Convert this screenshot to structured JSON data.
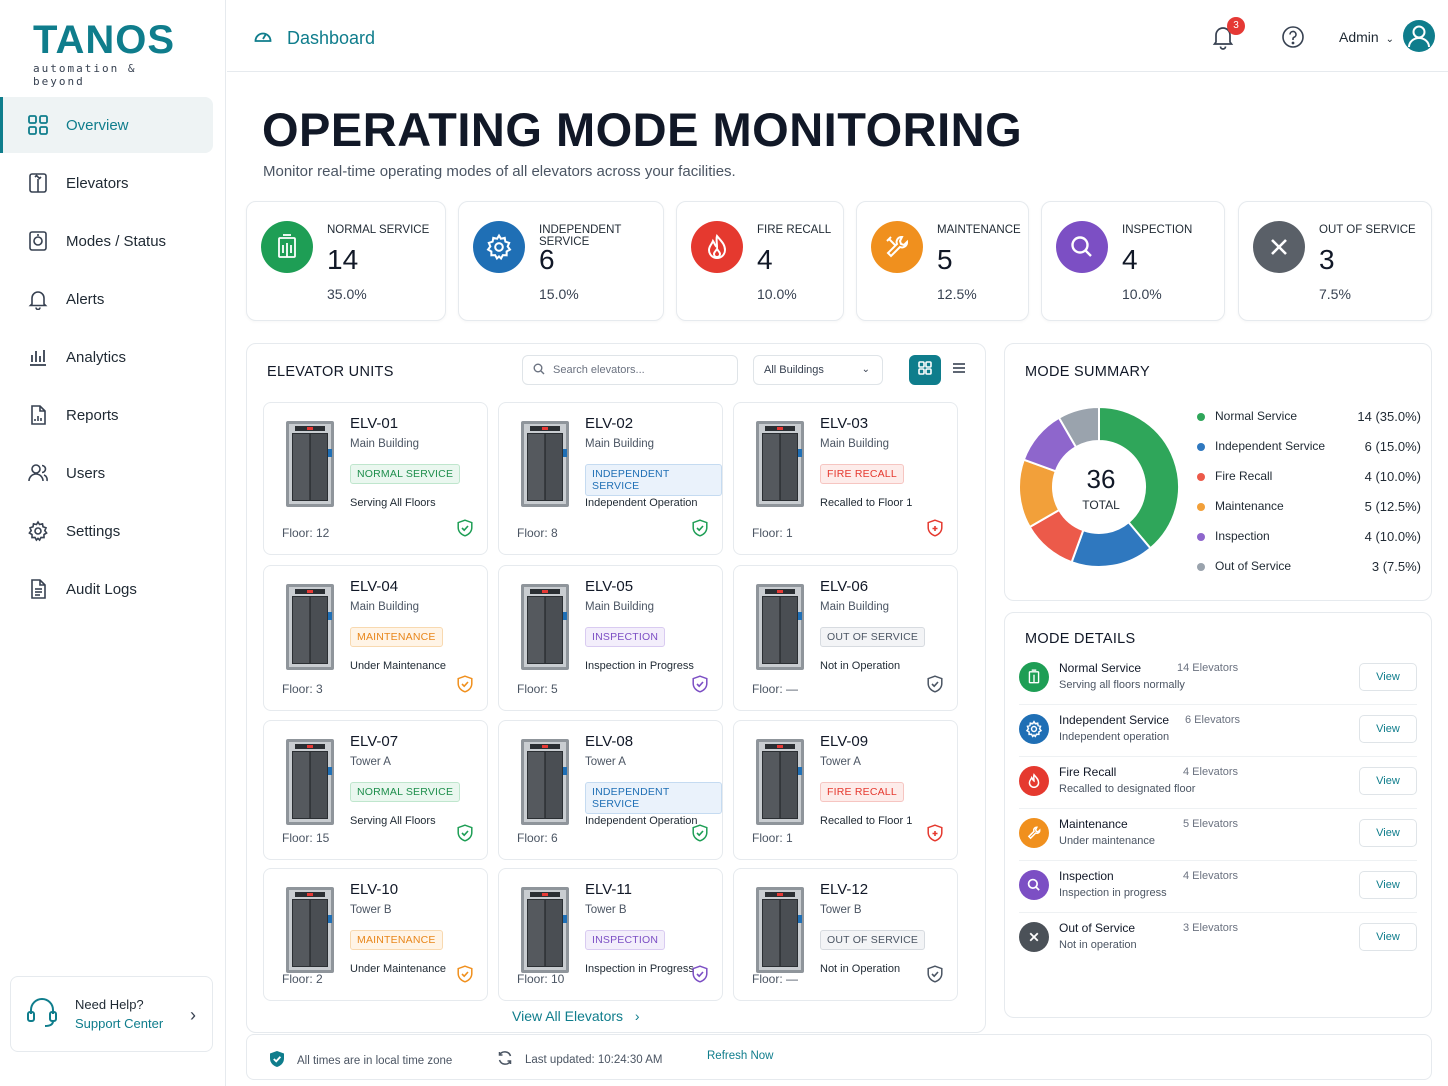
{
  "brand": {
    "name": "TANOS",
    "tagline": "automation & beyond"
  },
  "nav": {
    "items": [
      {
        "label": "Overview",
        "icon": "grid-icon"
      },
      {
        "label": "Elevators",
        "icon": "elevator-icon"
      },
      {
        "label": "Modes / Status",
        "icon": "mode-icon"
      },
      {
        "label": "Alerts",
        "icon": "bell-icon"
      },
      {
        "label": "Analytics",
        "icon": "bar-chart-icon"
      },
      {
        "label": "Reports",
        "icon": "report-icon"
      },
      {
        "label": "Users",
        "icon": "users-icon"
      },
      {
        "label": "Settings",
        "icon": "gear-icon"
      },
      {
        "label": "Audit Logs",
        "icon": "document-icon"
      }
    ],
    "active": "Overview"
  },
  "help": {
    "title": "Need Help?",
    "link": "Support Center"
  },
  "header": {
    "breadcrumb": "Dashboard",
    "notifications": "3",
    "user": "Admin"
  },
  "page": {
    "title": "OPERATING MODE MONITORING",
    "subtitle": "Monitor real-time operating modes of all elevators across your facilities."
  },
  "stats": [
    {
      "label": "NORMAL SERVICE",
      "count": "14",
      "percent": "35.0%",
      "color": "#1e9e55"
    },
    {
      "label": "INDEPENDENT SERVICE",
      "count": "6",
      "percent": "15.0%",
      "color": "#1f6fb5"
    },
    {
      "label": "FIRE RECALL",
      "count": "4",
      "percent": "10.0%",
      "color": "#e5392f"
    },
    {
      "label": "MAINTENANCE",
      "count": "5",
      "percent": "12.5%",
      "color": "#f0901e"
    },
    {
      "label": "INSPECTION",
      "count": "4",
      "percent": "10.0%",
      "color": "#7c4fc4"
    },
    {
      "label": "OUT OF SERVICE",
      "count": "3",
      "percent": "7.5%",
      "color": "#5a6068"
    }
  ],
  "units": {
    "title": "ELEVATOR UNITS",
    "search_placeholder": "Search elevators...",
    "building_filter": "All Buildings",
    "view_all": "View All Elevators",
    "elevators": [
      {
        "id": "ELV-01",
        "building": "Main Building",
        "mode": "NORMAL SERVICE",
        "detail": "Serving All Floors",
        "floor": "Floor: 12",
        "kind": "normal"
      },
      {
        "id": "ELV-02",
        "building": "Main Building",
        "mode": "INDEPENDENT SERVICE",
        "detail": "Independent Operation",
        "floor": "Floor: 8",
        "kind": "independent"
      },
      {
        "id": "ELV-03",
        "building": "Main Building",
        "mode": "FIRE RECALL",
        "detail": "Recalled to Floor 1",
        "floor": "Floor: 1",
        "kind": "fire"
      },
      {
        "id": "ELV-04",
        "building": "Main Building",
        "mode": "MAINTENANCE",
        "detail": "Under Maintenance",
        "floor": "Floor: 3",
        "kind": "maintenance"
      },
      {
        "id": "ELV-05",
        "building": "Main Building",
        "mode": "INSPECTION",
        "detail": "Inspection in Progress",
        "floor": "Floor: 5",
        "kind": "inspection"
      },
      {
        "id": "ELV-06",
        "building": "Main Building",
        "mode": "OUT OF SERVICE",
        "detail": "Not in Operation",
        "floor": "Floor: —",
        "kind": "out"
      },
      {
        "id": "ELV-07",
        "building": "Tower A",
        "mode": "NORMAL SERVICE",
        "detail": "Serving All Floors",
        "floor": "Floor: 15",
        "kind": "normal"
      },
      {
        "id": "ELV-08",
        "building": "Tower A",
        "mode": "INDEPENDENT SERVICE",
        "detail": "Independent Operation",
        "floor": "Floor: 6",
        "kind": "independent"
      },
      {
        "id": "ELV-09",
        "building": "Tower A",
        "mode": "FIRE RECALL",
        "detail": "Recalled to Floor 1",
        "floor": "Floor: 1",
        "kind": "fire"
      },
      {
        "id": "ELV-10",
        "building": "Tower B",
        "mode": "MAINTENANCE",
        "detail": "Under Maintenance",
        "floor": "Floor: 2",
        "kind": "maintenance"
      },
      {
        "id": "ELV-11",
        "building": "Tower B",
        "mode": "INSPECTION",
        "detail": "Inspection in Progress",
        "floor": "Floor: 10",
        "kind": "inspection"
      },
      {
        "id": "ELV-12",
        "building": "Tower B",
        "mode": "OUT OF SERVICE",
        "detail": "Not in Operation",
        "floor": "Floor: —",
        "kind": "out"
      }
    ]
  },
  "summary": {
    "title": "MODE SUMMARY",
    "total": "36",
    "total_label": "TOTAL",
    "legend": [
      {
        "name": "Normal Service",
        "value": "14 (35.0%)"
      },
      {
        "name": "Independent Service",
        "value": "6 (15.0%)"
      },
      {
        "name": "Fire Recall",
        "value": "4 (10.0%)"
      },
      {
        "name": "Maintenance",
        "value": "5 (12.5%)"
      },
      {
        "name": "Inspection",
        "value": "4 (10.0%)"
      },
      {
        "name": "Out of Service",
        "value": "3 (7.5%)"
      }
    ]
  },
  "chart_data": {
    "type": "pie",
    "categories": [
      "Normal Service",
      "Independent Service",
      "Fire Recall",
      "Maintenance",
      "Inspection",
      "Out of Service"
    ],
    "values": [
      14,
      6,
      4,
      5,
      4,
      3
    ],
    "colors": [
      "#2fa65a",
      "#2f78bf",
      "#ec5a4a",
      "#f2a03a",
      "#8e66cc",
      "#9aa3ad"
    ],
    "title": "MODE SUMMARY"
  },
  "details": {
    "title": "MODE DETAILS",
    "view_label": "View",
    "rows": [
      {
        "name": "Normal Service",
        "count": "14 Elevators",
        "desc": "Serving all floors normally"
      },
      {
        "name": "Independent Service",
        "count": "6 Elevators",
        "desc": "Independent operation"
      },
      {
        "name": "Fire Recall",
        "count": "4 Elevators",
        "desc": "Recalled to designated floor"
      },
      {
        "name": "Maintenance",
        "count": "5 Elevators",
        "desc": "Under maintenance"
      },
      {
        "name": "Inspection",
        "count": "4 Elevators",
        "desc": "Inspection in progress"
      },
      {
        "name": "Out of Service",
        "count": "3 Elevators",
        "desc": "Not in operation"
      }
    ]
  },
  "footer": {
    "timezone": "All times are in local time zone",
    "last_updated": "Last updated:  10:24:30 AM",
    "refresh": "Refresh Now"
  }
}
